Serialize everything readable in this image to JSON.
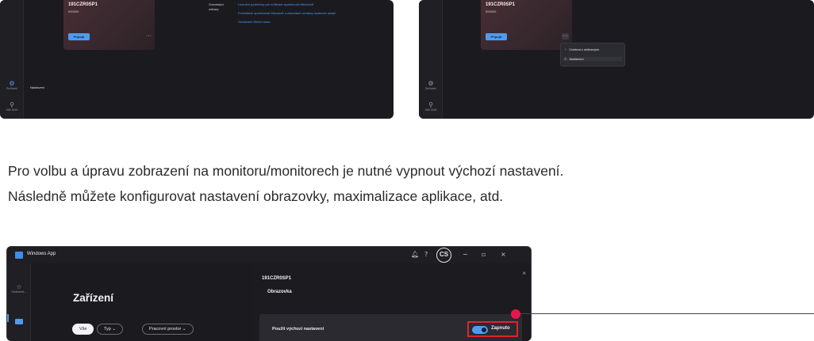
{
  "top_left": {
    "device": {
      "name": "191CZR0SP1",
      "code": "000000",
      "connect_label": "Připojit",
      "more": "···"
    },
    "related": {
      "label": "Související odkazy",
      "links": [
        "Licenční podmínky pro software společnosti Microsoft",
        "Prohlášení společnosti Microsoft o zásadách ochrany osobních údajů",
        "Oznámení třetích stran"
      ]
    },
    "rail": {
      "active_label": "Zařízení",
      "bottom_label": "Váš účet",
      "active_icon": "gear-icon",
      "bottom_icon": "account-icon"
    },
    "nav_label": "Nastavení"
  },
  "top_right": {
    "device": {
      "name": "191CZR0SP1",
      "code": "000000",
      "connect_label": "Připojit",
      "more": "···"
    },
    "rail": {
      "active_label": "Zařízení",
      "bottom_label": "Váš účet"
    },
    "menu": [
      {
        "icon": "unpin-icon",
        "label": "Odebrat z oblíbených"
      },
      {
        "icon": "settings-icon",
        "label": "Nastavení",
        "selected": true
      }
    ]
  },
  "paragraph": {
    "line1": "Pro volbu a úpravu zobrazení na monitoru/monitorech je nutné vypnout výchozí nastavení.",
    "line2": "Následně můžete konfigurovat nastavení obrazovky, maximalizace aplikace, atd."
  },
  "bottom": {
    "app_title": "Windows App",
    "titlebar_icons": [
      "bell-icon",
      "help-icon",
      "minimize-icon",
      "maximize-icon",
      "close-icon"
    ],
    "avatar_initials": "CS",
    "rail": {
      "item1_label": "Oblíbené...",
      "item1_icon": "star-icon",
      "item2_icon": "devices-icon"
    },
    "page_title": "Zařízení",
    "filters": [
      "Vše",
      "Typ",
      "Pracovní prostor"
    ],
    "panel": {
      "device_name": "191CZR0SP1",
      "section": "Obrazovka",
      "setting_label": "Použít výchozí nastavení",
      "toggle_state": "Zapnuto",
      "toggle_on": true
    }
  }
}
